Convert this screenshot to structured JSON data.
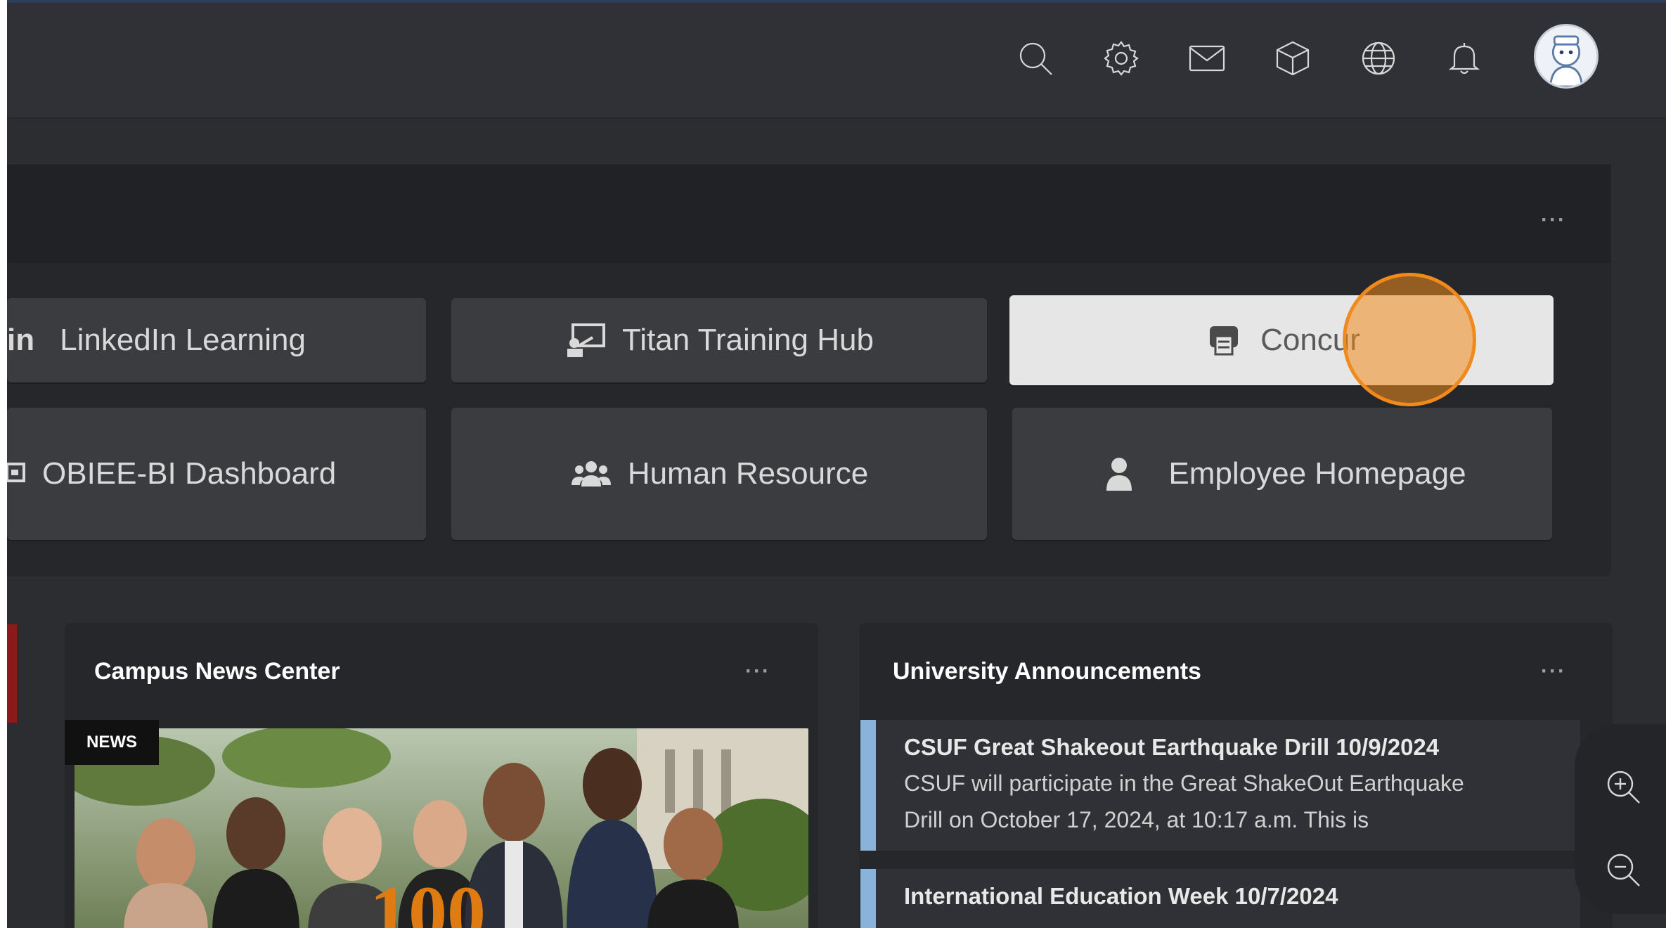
{
  "colors": {
    "background": "#2b2d31",
    "panel": "#25272b",
    "button": "#3a3c40",
    "active_button": "#e6e6e6",
    "accent_orange": "#f08a1c",
    "announcement_bar": "#8ab3d9"
  },
  "topbar": {
    "icons": [
      "search-icon",
      "gear-icon",
      "mail-icon",
      "cube-icon",
      "globe-icon",
      "bell-icon"
    ]
  },
  "quick_links": {
    "more": "···",
    "items": [
      {
        "label": "LinkedIn Learning",
        "icon": "linkedin-icon",
        "prefix": "in"
      },
      {
        "label": "Titan Training Hub",
        "icon": "presentation-icon"
      },
      {
        "label": "Concur",
        "icon": "printer-icon",
        "active": true
      },
      {
        "label": "OBIEE-BI Dashboard",
        "icon": "dashboard-icon"
      },
      {
        "label": "Human Resource",
        "icon": "users-icon"
      },
      {
        "label": "Employee Homepage",
        "icon": "user-icon"
      }
    ]
  },
  "news": {
    "title": "Campus News Center",
    "more": "···",
    "badge": "NEWS"
  },
  "announcements": {
    "title": "University Announcements",
    "more": "···",
    "items": [
      {
        "title": "CSUF Great Shakeout Earthquake Drill 10/9/2024",
        "line1": "CSUF will participate in the Great ShakeOut Earthquake",
        "line2": "Drill on October 17, 2024, at 10:17 a.m.  This is"
      },
      {
        "title": "International Education Week 10/7/2024"
      }
    ]
  },
  "zoom": {
    "icons": [
      "zoom-in-icon",
      "zoom-out-icon"
    ]
  }
}
